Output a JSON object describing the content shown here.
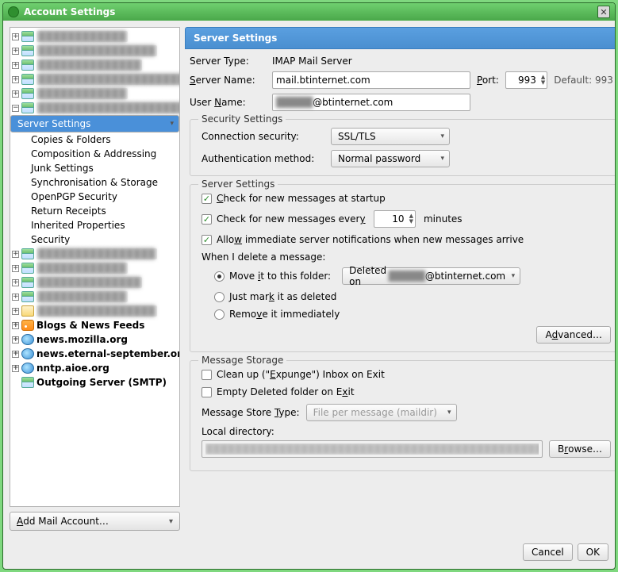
{
  "window": {
    "title": "Account Settings"
  },
  "sidebar": {
    "accounts_blur": [
      "████████████",
      "████████████████",
      "██████████████",
      "████████████████████",
      "████████████",
      "████████████████████"
    ],
    "selected_children": [
      "Server Settings",
      "Copies & Folders",
      "Composition & Addressing",
      "Junk Settings",
      "Synchronisation & Storage",
      "OpenPGP Security",
      "Return Receipts",
      "Inherited Properties",
      "Security"
    ],
    "more_blur": [
      "████████████████",
      "████████████",
      "██████████████",
      "████████████"
    ],
    "talk_blur": "████████████████",
    "bold_items": [
      "Blogs & News Feeds",
      "news.mozilla.org",
      "news.eternal-september.org",
      "nntp.aioe.org",
      "Outgoing Server (SMTP)"
    ],
    "add_label_pre": "A",
    "add_label_rest": "dd Mail Account…"
  },
  "header": {
    "title": "Server Settings"
  },
  "server": {
    "type_label": "Server Type:",
    "type_value": "IMAP Mail Server",
    "name_label_pre": "S",
    "name_label_rest": "erver Name:",
    "name_value": "mail.btinternet.com",
    "port_label_pre": "P",
    "port_label_rest": "ort:",
    "port_value": "993",
    "default_port": "Default: 993",
    "user_label_pre": "User ",
    "user_label_u": "N",
    "user_label_rest": "ame:",
    "user_blur": "█████",
    "user_suffix": "@btinternet.com"
  },
  "security": {
    "legend": "Security Settings",
    "conn_label": "Connection security:",
    "conn_value": "SSL/TLS",
    "auth_label": "Authentication method:",
    "auth_value": "Normal password"
  },
  "settings": {
    "legend": "Server Settings",
    "chk_startup_pre": "C",
    "chk_startup_rest": "heck for new messages at startup",
    "chk_every_pre": "Check for new messages ever",
    "chk_every_u": "y",
    "every_value": "10",
    "minutes": "minutes",
    "chk_allow_pre": "Allo",
    "chk_allow_u": "w",
    "chk_allow_rest": " immediate server notifications when new messages arrive",
    "delete_label": "When I delete a message:",
    "r1_pre": "Move ",
    "r1_u": "i",
    "r1_rest": "t to this folder:",
    "folder_pre": "Deleted on ",
    "folder_blur": "█████",
    "folder_suf": "@btinternet.com",
    "r2_pre": "Just mar",
    "r2_u": "k",
    "r2_rest": " it as deleted",
    "r3_pre": "Remo",
    "r3_u": "v",
    "r3_rest": "e it immediately",
    "advanced_pre": "A",
    "advanced_u": "d",
    "advanced_rest": "vanced…"
  },
  "storage": {
    "legend": "Message Storage",
    "expunge_pre": "Clean up (\"",
    "expunge_u": "E",
    "expunge_rest": "xpunge\") Inbox on Exit",
    "empty_pre": "Empty Deleted folder on E",
    "empty_u": "x",
    "empty_rest": "it",
    "store_label_pre": "Message Store ",
    "store_label_u": "T",
    "store_label_rest": "ype:",
    "store_value": "File per message (maildir)",
    "localdir": "Local directory:",
    "browse_pre": "B",
    "browse_u": "r",
    "browse_rest": "owse…"
  },
  "footer": {
    "cancel": "Cancel",
    "ok": "OK"
  }
}
